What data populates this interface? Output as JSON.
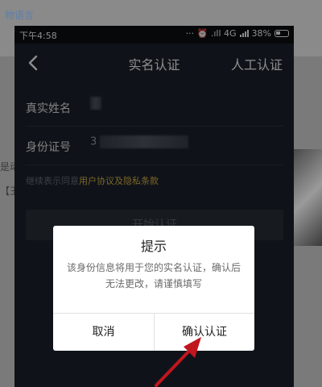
{
  "background": {
    "top_fragment": "物语言",
    "left_fragment_1": "是动",
    "left_fragment_2": "【王"
  },
  "status_bar": {
    "time": "下午4:58",
    "icons_text": "··· ⏰ .ıll 4G",
    "battery_percent": "38%"
  },
  "nav": {
    "title": "实名认证",
    "right_action": "人工认证",
    "back_icon": "chevron-left-icon"
  },
  "form": {
    "name_label": "真实姓名",
    "id_label": "身份证号",
    "id_value_prefix": "3"
  },
  "agreement": {
    "prefix": "继续表示同意",
    "link": "用户协议及隐私条款"
  },
  "start_button": "开始认证",
  "dialog": {
    "title": "提示",
    "message": "该身份信息将用于您的实名认证，确认后无法更改，请谨慎填写",
    "cancel": "取消",
    "confirm": "确认认证"
  },
  "colors": {
    "screen_bg": "#1d232e",
    "link": "#e0b84a",
    "annotation_arrow": "#c0161e"
  }
}
